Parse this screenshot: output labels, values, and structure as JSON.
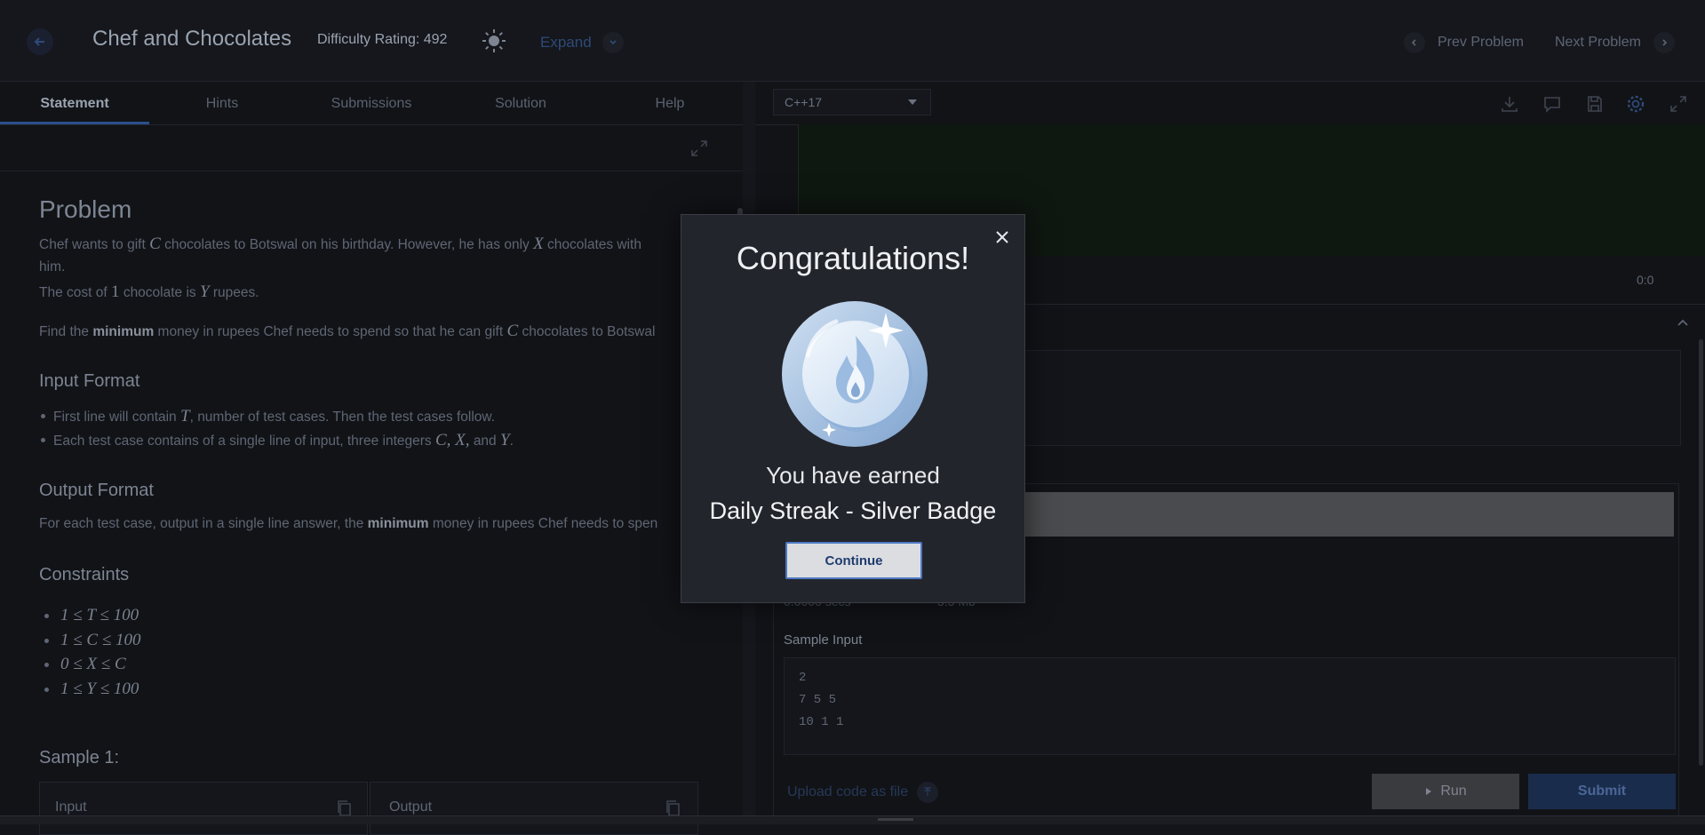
{
  "header": {
    "title": "Chef and Chocolates",
    "difficulty": "Difficulty Rating: 492",
    "expand_label": "Expand",
    "prev_label": "Prev Problem",
    "next_label": "Next Problem"
  },
  "tabs": [
    {
      "label": "Statement",
      "active": true
    },
    {
      "label": "Hints"
    },
    {
      "label": "Submissions"
    },
    {
      "label": "Solution"
    },
    {
      "label": "Help"
    }
  ],
  "problem": {
    "heading": "Problem",
    "line1_a": "Chef wants to gift",
    "line1_var1": "C",
    "line1_b": "chocolates to Botswal on his birthday. However, he has only",
    "line1_var2": "X",
    "line1_c": "chocolates with",
    "line2": "him.",
    "line3_a": "The cost of",
    "line3_num": "1",
    "line3_b": "chocolate is",
    "line3_var": "Y",
    "line3_c": "rupees.",
    "line4_a": "Find the",
    "line4_bold": "minimum",
    "line4_b": "money in rupees Chef needs to spend so that he can gift",
    "line4_var": "C",
    "line4_c": "chocolates to Botswal"
  },
  "input_format": {
    "heading": "Input Format",
    "b1_a": "First line will contain",
    "b1_var": "T",
    "b1_b": ", number of test cases. Then the test cases follow.",
    "b2_a": "Each test case contains of a single line of input, three integers",
    "b2_vars": "C, X,",
    "b2_and": "and",
    "b2_var": "Y",
    "b2_end": "."
  },
  "output_format": {
    "heading": "Output Format",
    "a": "For each test case, output in a single line answer, the",
    "bold": "minimum",
    "b": "money in rupees Chef needs to spen"
  },
  "constraints": {
    "heading": "Constraints",
    "items": [
      "1 ≤ T ≤ 100",
      "1 ≤ C ≤ 100",
      "0 ≤ X ≤ C",
      "1 ≤ Y ≤ 100"
    ]
  },
  "sample": {
    "heading": "Sample 1:",
    "input_label": "Input",
    "output_label": "Output"
  },
  "editor": {
    "language": "C++17",
    "cursor_position": "0:0"
  },
  "results": {
    "time": "0.0000 secs",
    "memory": "5.5 Mb",
    "sample_input_label": "Sample Input",
    "sample_input_lines": [
      "2",
      "7 5 5",
      "10 1 1"
    ]
  },
  "actions": {
    "upload_label": "Upload code as file",
    "run_label": "Run",
    "submit_label": "Submit"
  },
  "modal": {
    "title": "Congratulations!",
    "earned": "You have earned",
    "badge_name": "Daily Streak - Silver Badge",
    "continue_label": "Continue",
    "badge_icon": "silver-flame-badge-icon"
  }
}
